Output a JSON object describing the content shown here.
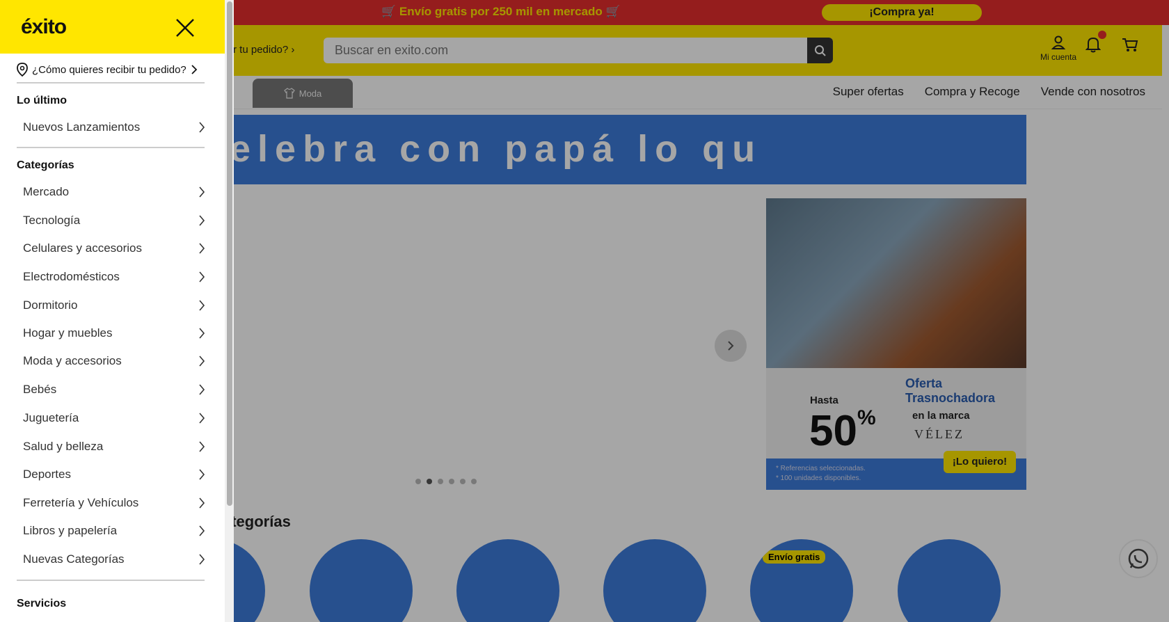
{
  "topbar": {
    "message": "🛒 Envío gratis por 250 mil en mercado 🛒",
    "cta": "¡Compra ya!"
  },
  "header": {
    "deliver_partial": "ibir tu pedido?",
    "search_placeholder": "Buscar en exito.com",
    "account_label": "Mi cuenta"
  },
  "navbar": {
    "active_tab": "Moda",
    "links": [
      "Super ofertas",
      "Compra y Recoge",
      "Vende con nosotros"
    ]
  },
  "banner": {
    "text": "elebra con papá lo qu"
  },
  "promo": {
    "brand": "Oferta Trasnochadora",
    "hasta": "Hasta",
    "percent": "50",
    "percent_sign": "%",
    "en_la_marca": "en la marca",
    "brand_name": "VÉLEZ",
    "fine_print": "* Referencias seleccionadas.\n* 100 unidades disponibles.",
    "cta": "¡Lo quiero!"
  },
  "carousel": {
    "dot_count": 6,
    "active_index": 1
  },
  "categories": {
    "heading": "ategorías",
    "badge": "Envío gratis"
  },
  "drawer": {
    "logo": "éxito",
    "deliver_question": "¿Cómo quieres recibir tu pedido?",
    "sections": [
      {
        "title": "Lo último",
        "items": [
          "Nuevos Lanzamientos"
        ]
      },
      {
        "title": "Categorías",
        "items": [
          "Mercado",
          "Tecnología",
          "Celulares y accesorios",
          "Electrodomésticos",
          "Dormitorio",
          "Hogar y muebles",
          "Moda y accesorios",
          "Bebés",
          "Juguetería",
          "Salud y belleza",
          "Deportes",
          "Ferretería y Vehículos",
          "Libros y papelería",
          "Nuevas Categorías"
        ]
      },
      {
        "title": "Servicios",
        "items": []
      }
    ]
  },
  "colors": {
    "brand_yellow": "#ffe600",
    "brand_red": "#e52d2d",
    "accent_blue": "#3c7bdb"
  }
}
